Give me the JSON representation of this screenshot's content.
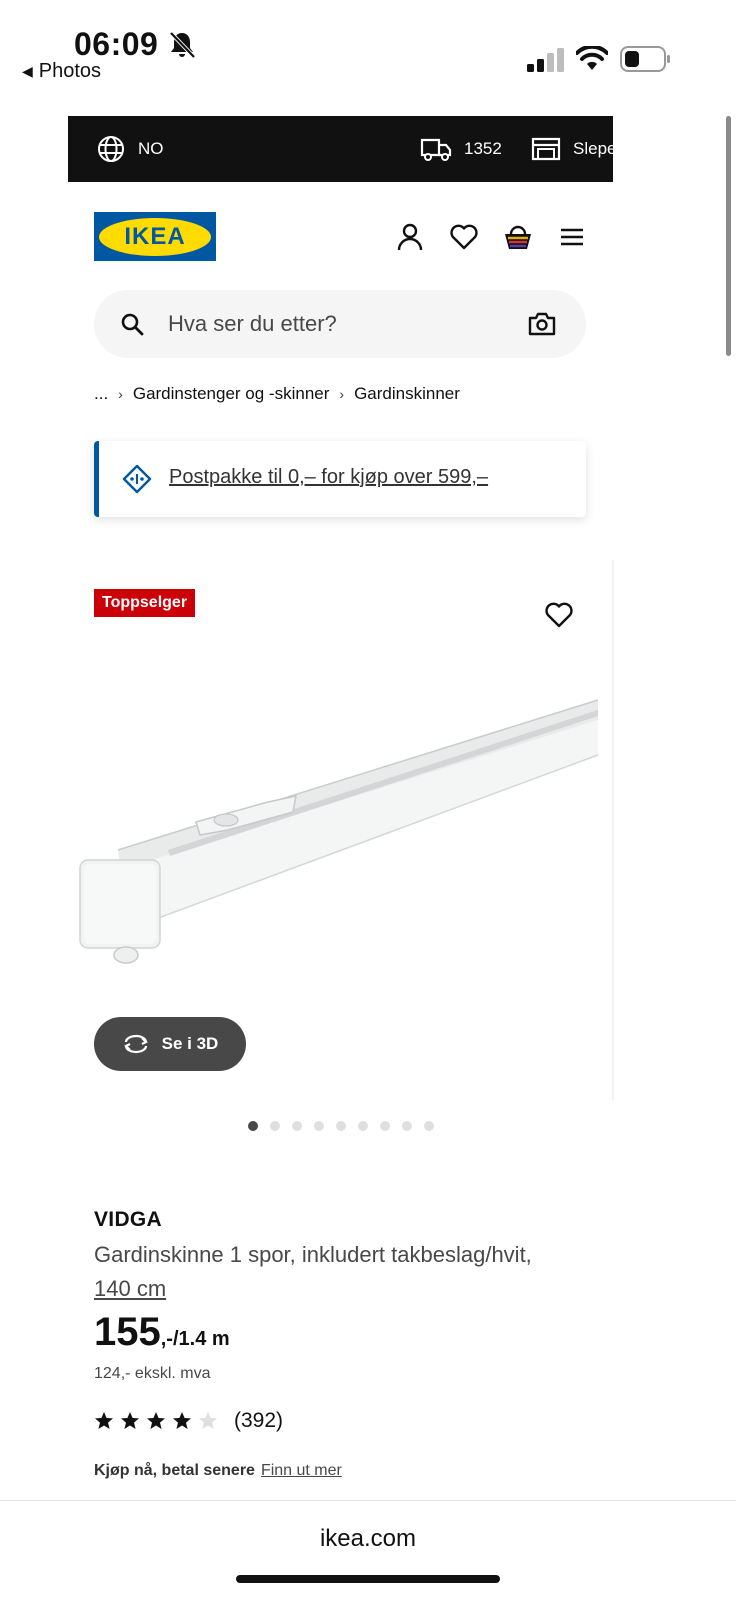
{
  "status_bar": {
    "time": "06:09",
    "back_label": "Photos",
    "icons": [
      "bell-slash-icon",
      "cellular-signal-icon",
      "wifi-icon",
      "battery-icon"
    ]
  },
  "top_bar": {
    "country": "NO",
    "postcode": "1352",
    "store": "Slependen",
    "icons": [
      "globe-icon",
      "truck-icon",
      "store-icon"
    ]
  },
  "header": {
    "logo_text": "IKEA",
    "icons": [
      "account-icon",
      "heart-icon",
      "cart-icon",
      "menu-icon"
    ]
  },
  "search": {
    "placeholder": "Hva ser du etter?",
    "icons": [
      "search-icon",
      "camera-icon"
    ]
  },
  "breadcrumb": {
    "ellipsis": "...",
    "items": [
      "Gardinstenger og -skinner",
      "Gardinskinner"
    ]
  },
  "promo": {
    "text": "Postpakke til 0,– for kjøp over 599,–"
  },
  "gallery": {
    "badge": "Toppselger",
    "button_3d": "Se i 3D",
    "dot_count": 9,
    "active_dot": 0
  },
  "product": {
    "name": "VIDGA",
    "description": "Gardinskinne 1 spor, inkludert takbeslag/hvit,",
    "size": "140 cm",
    "price_int": "155",
    "price_suffix": ",-/1.4 m",
    "price_ex_vat": "124,- ekskl. mva",
    "rating": 4,
    "rating_max": 5,
    "review_count": "(392)",
    "klarna_label": "Kjøp nå, betal senere",
    "klarna_link": "Finn ut mer"
  },
  "browser": {
    "url": "ikea.com"
  },
  "colors": {
    "ikea_blue": "#0058a3",
    "ikea_yellow": "#ffdb00",
    "badge_red": "#cc0008",
    "dark_bar": "#111111"
  }
}
